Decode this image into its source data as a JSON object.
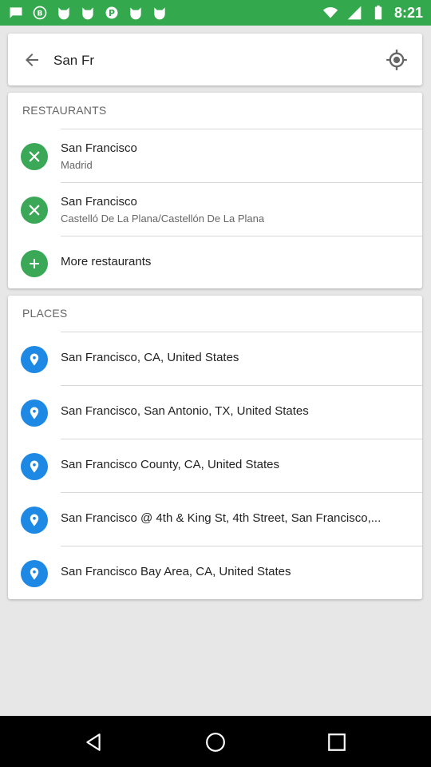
{
  "status_bar": {
    "time": "8:21"
  },
  "search": {
    "value": "San Fr"
  },
  "restaurants": {
    "header": "RESTAURANTS",
    "items": [
      {
        "title": "San Francisco",
        "subtitle": "Madrid"
      },
      {
        "title": "San Francisco",
        "subtitle": "Castelló De La Plana/Castellón De La Plana"
      }
    ],
    "more_label": "More restaurants"
  },
  "places": {
    "header": "PLACES",
    "items": [
      {
        "title": "San Francisco, CA, United States"
      },
      {
        "title": "San Francisco, San Antonio, TX, United States"
      },
      {
        "title": "San Francisco County, CA, United States"
      },
      {
        "title": "San Francisco @ 4th & King St, 4th Street, San Francisco,..."
      },
      {
        "title": "San Francisco Bay Area, CA, United States"
      }
    ]
  },
  "colors": {
    "status_bar": "#33a84d",
    "restaurant_icon": "#3aa856",
    "place_icon": "#1e88e5"
  }
}
